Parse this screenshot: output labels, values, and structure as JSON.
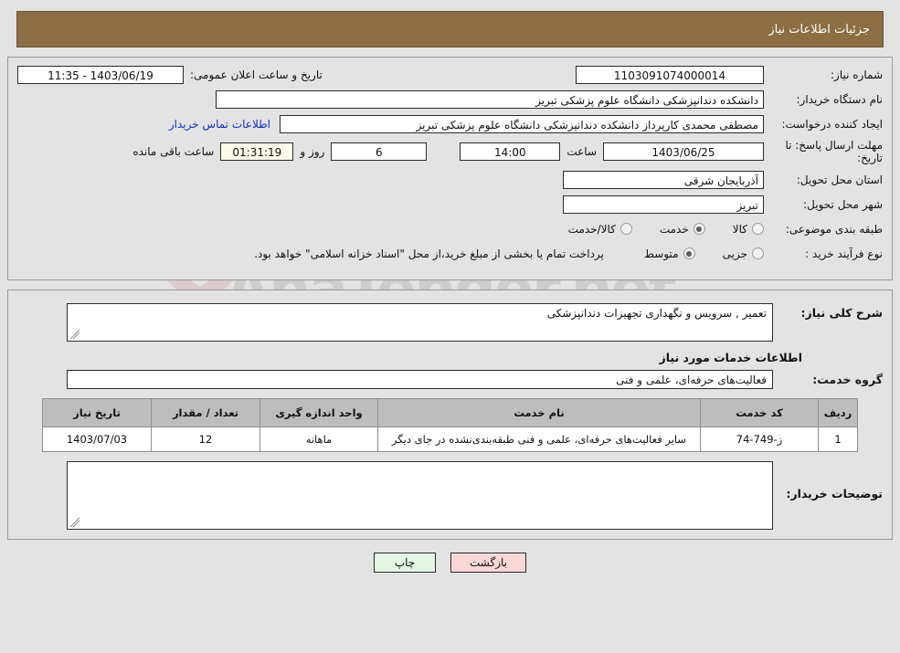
{
  "header": {
    "title": "جزئیات اطلاعات نیاز"
  },
  "watermark": {
    "text": "AnaTender.net"
  },
  "top_form": {
    "need_number": {
      "label": "شماره نیاز:",
      "value": "1103091074000014"
    },
    "announce": {
      "label": "تاریخ و ساعت اعلان عمومی:",
      "value": "11:35 - 1403/06/19"
    },
    "buyer_org": {
      "label": "نام دستگاه خریدار:",
      "value": "دانشکده دندانپزشکی دانشگاه علوم پزشکی تبریز"
    },
    "creator": {
      "label": "ایجاد کننده درخواست:",
      "value": "مصطفی محمدی کارپرداز دانشکده دندانپزشکی دانشگاه علوم پزشکی تبریز",
      "contact_link": "اطلاعات تماس خریدار"
    },
    "deadline": {
      "label": "مهلت ارسال پاسخ: تا تاریخ:",
      "date": "1403/06/25",
      "time_label": "ساعت",
      "time": "14:00",
      "days": "6",
      "days_label": "روز و",
      "timer": "01:31:19",
      "timer_label": "ساعت باقی مانده"
    },
    "province": {
      "label": "استان محل تحویل:",
      "value": "آذربایجان شرقی"
    },
    "city": {
      "label": "شهر محل تحویل:",
      "value": "تبریز"
    },
    "classification": {
      "label": "طبقه بندی موضوعی:",
      "options": [
        {
          "label": "کالا",
          "selected": false
        },
        {
          "label": "خدمت",
          "selected": true
        },
        {
          "label": "کالا/خدمت",
          "selected": false
        }
      ]
    },
    "process_type": {
      "label": "نوع فرآیند خرید :",
      "options": [
        {
          "label": "جزیی",
          "selected": false
        },
        {
          "label": "متوسط",
          "selected": true
        }
      ],
      "note": "پرداخت تمام یا بخشی از مبلغ خرید،از محل \"اسناد خزانه اسلامی\" خواهد بود."
    }
  },
  "details": {
    "general_description": {
      "label": "شرح کلی نیاز:",
      "value": "تعمیر , سرویس و نگهداری تجهیزات دندانپزشکی"
    },
    "services_heading": "اطلاعات خدمات مورد نیاز",
    "service_group": {
      "label": "گروه خدمت:",
      "value": "فعالیت‌های حرفه‌ای، علمی و فنی"
    },
    "table": {
      "columns": [
        "ردیف",
        "کد خدمت",
        "نام خدمت",
        "واحد اندازه گیری",
        "تعداد / مقدار",
        "تاریخ نیاز"
      ],
      "rows": [
        {
          "radif": "1",
          "code": "ز-749-74",
          "name": "سایر فعالیت‌های حرفه‌ای، علمی و فنی طبقه‌بندی‌نشده در جای دیگر",
          "unit": "ماهانه",
          "quantity": "12",
          "need_date": "1403/07/03"
        }
      ]
    },
    "buyer_notes": {
      "label": "توضیحات خریدار:",
      "value": ""
    }
  },
  "footer": {
    "print_button": "چاپ",
    "back_button": "بازگشت"
  }
}
